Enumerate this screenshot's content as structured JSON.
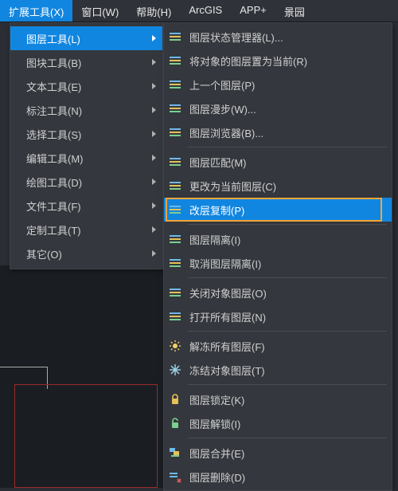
{
  "menubar": {
    "items": [
      {
        "label": "扩展工具(X)",
        "active": true
      },
      {
        "label": "窗口(W)"
      },
      {
        "label": "帮助(H)"
      },
      {
        "label": "ArcGIS"
      },
      {
        "label": "APP+"
      },
      {
        "label": "景园"
      }
    ]
  },
  "submenu1": {
    "items": [
      {
        "label": "图层工具(L)",
        "active": true
      },
      {
        "label": "图块工具(B)"
      },
      {
        "label": "文本工具(E)"
      },
      {
        "label": "标注工具(N)"
      },
      {
        "label": "选择工具(S)"
      },
      {
        "label": "编辑工具(M)"
      },
      {
        "label": "绘图工具(D)"
      },
      {
        "label": "文件工具(F)"
      },
      {
        "label": "定制工具(T)"
      },
      {
        "label": "其它(O)"
      }
    ]
  },
  "submenu2": {
    "groups": [
      [
        {
          "icon": "layer-state-icon",
          "label": "图层状态管理器(L)...",
          "name": "layer-state-manager"
        },
        {
          "icon": "current-layer-icon",
          "label": "将对象的图层置为当前(R)",
          "name": "make-object-layer-current"
        },
        {
          "icon": "prev-layer-icon",
          "label": "上一个图层(P)",
          "name": "previous-layer"
        },
        {
          "icon": "layer-walk-icon",
          "label": "图层漫步(W)...",
          "name": "layer-walk"
        },
        {
          "icon": "layer-browse-icon",
          "label": "图层浏览器(B)...",
          "name": "layer-browser"
        }
      ],
      [
        {
          "icon": "layer-match-icon",
          "label": "图层匹配(M)",
          "name": "layer-match"
        },
        {
          "icon": "change-layer-icon",
          "label": "更改为当前图层(C)",
          "name": "change-to-current-layer"
        },
        {
          "icon": "layer-copy-icon",
          "label": "改层复制(P)",
          "name": "layer-copy-change",
          "highlighted": true,
          "orange": true
        }
      ],
      [
        {
          "icon": "layer-isolate-icon",
          "label": "图层隔离(I)",
          "name": "layer-isolate"
        },
        {
          "icon": "layer-unisolate-icon",
          "label": "取消图层隔离(I)",
          "name": "layer-unisolate"
        }
      ],
      [
        {
          "icon": "layer-off-icon",
          "label": "关闭对象图层(O)",
          "name": "close-object-layer"
        },
        {
          "icon": "layer-on-all-icon",
          "label": "打开所有图层(N)",
          "name": "open-all-layers"
        }
      ],
      [
        {
          "icon": "thaw-all-icon",
          "label": "解冻所有图层(F)",
          "name": "thaw-all-layers"
        },
        {
          "icon": "freeze-obj-icon",
          "label": "冻结对象图层(T)",
          "name": "freeze-object-layer"
        }
      ],
      [
        {
          "icon": "layer-lock-icon",
          "label": "图层锁定(K)",
          "name": "layer-lock"
        },
        {
          "icon": "layer-unlock-icon",
          "label": "图层解锁(I)",
          "name": "layer-unlock"
        }
      ],
      [
        {
          "icon": "layer-merge-icon",
          "label": "图层合并(E)",
          "name": "layer-merge"
        },
        {
          "icon": "layer-delete-icon",
          "label": "图层删除(D)",
          "name": "layer-delete"
        }
      ]
    ]
  },
  "colors": {
    "accent": "#1186e0",
    "highlight_border": "#f2a63a"
  }
}
